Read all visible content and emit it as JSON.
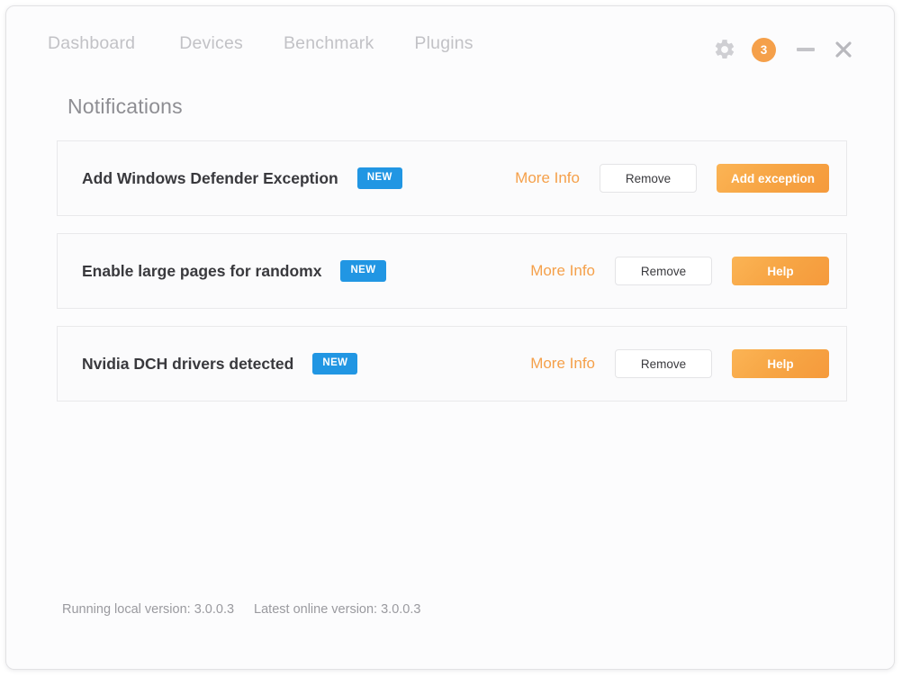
{
  "window": {
    "nav": [
      {
        "label": "Dashboard",
        "name": "nav-dashboard"
      },
      {
        "label": "Devices",
        "name": "nav-devices"
      },
      {
        "label": "Benchmark",
        "name": "nav-benchmark"
      },
      {
        "label": "Plugins",
        "name": "nav-plugins"
      }
    ],
    "controls": {
      "gear_icon": "gear-icon",
      "notification_count": "3",
      "minimize_icon": "minimize-icon",
      "close_icon": "close-icon"
    }
  },
  "page": {
    "title": "Notifications"
  },
  "notifications": [
    {
      "title": "Add Windows Defender Exception",
      "badge": "NEW",
      "more_info": "More Info",
      "remove": "Remove",
      "action": "Add exception"
    },
    {
      "title": "Enable large pages for randomx",
      "badge": "NEW",
      "more_info": "More Info",
      "remove": "Remove",
      "action": "Help"
    },
    {
      "title": "Nvidia DCH drivers detected",
      "badge": "NEW",
      "more_info": "More Info",
      "remove": "Remove",
      "action": "Help"
    }
  ],
  "footer": {
    "local_version": "Running local version: 3.0.0.3",
    "online_version": "Latest online version: 3.0.0.3"
  },
  "colors": {
    "accent_orange": "#f5a04a",
    "badge_blue": "#2196e3",
    "nav_text": "#c2c2c6",
    "title_text": "#8e8e93",
    "card_border": "#e9e9eb"
  }
}
